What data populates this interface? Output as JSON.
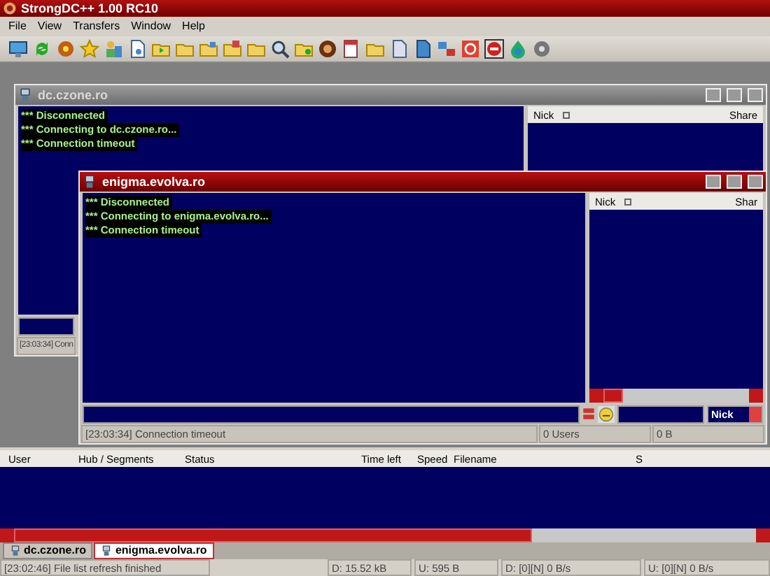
{
  "window": {
    "title": "StrongDC++ 1.00 RC10"
  },
  "menu": [
    "File",
    "View",
    "Transfers",
    "Window",
    "Help"
  ],
  "hub_windows": [
    {
      "title": "dc.czone.ro",
      "active": false,
      "chat": [
        "*** Disconnected",
        "*** Connecting to dc.czone.ro...",
        "*** Connection timeout"
      ],
      "userlist_columns": [
        "Nick",
        "Share"
      ],
      "status": "[23:03:34] Conn"
    },
    {
      "title": "enigma.evolva.ro",
      "active": true,
      "chat": [
        "*** Disconnected",
        "*** Connecting to enigma.evolva.ro...",
        "*** Connection timeout"
      ],
      "userlist_columns": [
        "Nick",
        "Shar"
      ],
      "status": "[23:03:34] Connection timeout",
      "users": "0 Users",
      "share": "0 B",
      "search_type": "Nick"
    }
  ],
  "transfers": {
    "columns": [
      "User",
      "Hub / Segments",
      "Status",
      "Time left",
      "Speed",
      "Filename",
      "S"
    ]
  },
  "tabs": [
    {
      "label": "dc.czone.ro",
      "selected": false
    },
    {
      "label": "enigma.evolva.ro",
      "selected": true
    }
  ],
  "status_bar": [
    "[23:02:46] File list refresh finished",
    "D: 15.52 kB",
    "U: 595 B",
    "D: [0][N] 0 B/s",
    "U: [0][N] 0 B/s"
  ]
}
